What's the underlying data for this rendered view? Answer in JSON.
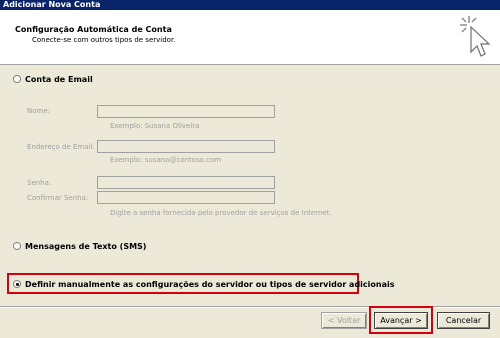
{
  "window": {
    "title": "Adicionar Nova Conta"
  },
  "header": {
    "title": "Configuração Automática de Conta",
    "subtitle": "Conecte-se com outros tipos de servidor."
  },
  "options": {
    "email": {
      "label": "Conta de Email",
      "selected": false
    },
    "sms": {
      "label": "Mensagens de Texto (SMS)",
      "selected": false
    },
    "manual": {
      "label": "Definir manualmente as configurações do servidor ou tipos de servidor adicionais",
      "selected": true
    }
  },
  "fields": {
    "name": {
      "label": "Nome:",
      "value": "",
      "hint": "Exemplo: Susana Oliveira"
    },
    "email": {
      "label": "Endereço de Email:",
      "value": "",
      "hint": "Exemplo: susana@contoso.com"
    },
    "password": {
      "label": "Senha:",
      "value": ""
    },
    "confirm_password": {
      "label": "Confirmar Senha:",
      "value": "",
      "hint": "Digite a senha fornecida pelo provedor de serviços de Internet."
    }
  },
  "buttons": {
    "back": "< Voltar",
    "next": "Avançar >",
    "cancel": "Cancelar"
  },
  "colors": {
    "title_bar": "#0a246a",
    "highlight": "#d6000f",
    "dialog_background": "#ece9d8",
    "disabled_text": "#a0a0a0"
  },
  "icons": {
    "header": "cursor-click-icon"
  }
}
